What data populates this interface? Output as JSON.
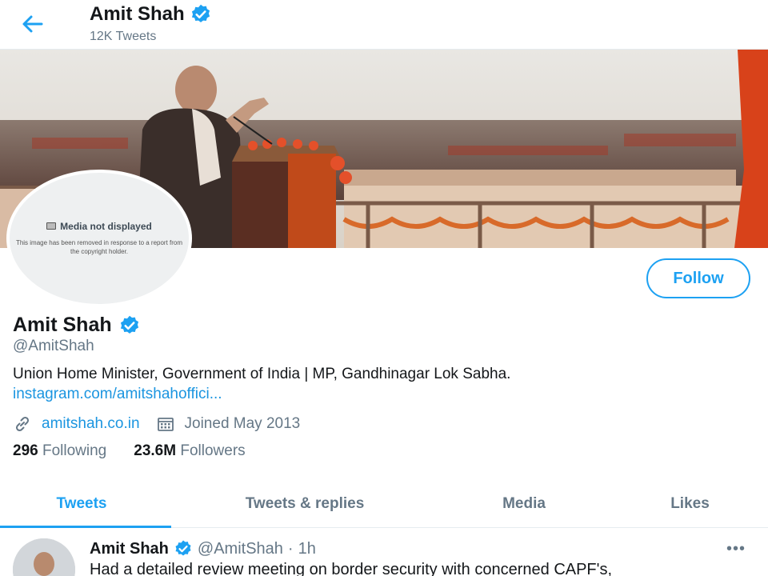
{
  "header": {
    "name": "Amit Shah",
    "tweet_count": "12K Tweets",
    "back_icon": "arrow-left-icon"
  },
  "avatar": {
    "media_title": "Media not displayed",
    "media_text": "This image has been removed in response to a report from the copyright holder."
  },
  "profile": {
    "follow_label": "Follow",
    "name": "Amit Shah",
    "handle": "@AmitShah",
    "bio": "Union Home Minister, Government of India | MP, Gandhinagar Lok Sabha.",
    "bio_link": "instagram.com/amitshahoffici...",
    "website": "amitshah.co.in",
    "joined": "Joined May 2013",
    "following_count": "296",
    "following_label": "Following",
    "followers_count": "23.6M",
    "followers_label": "Followers"
  },
  "tabs": [
    {
      "label": "Tweets",
      "active": true
    },
    {
      "label": "Tweets & replies",
      "active": false
    },
    {
      "label": "Media",
      "active": false
    },
    {
      "label": "Likes",
      "active": false
    }
  ],
  "tweet": {
    "name": "Amit Shah",
    "handle": "@AmitShah",
    "separator": "·",
    "time": "1h",
    "text": "Had a detailed review meeting on border security with concerned CAPF's,",
    "more": "•••"
  },
  "colors": {
    "accent": "#1da1f2",
    "link": "#1b95e0",
    "muted": "#657786"
  }
}
